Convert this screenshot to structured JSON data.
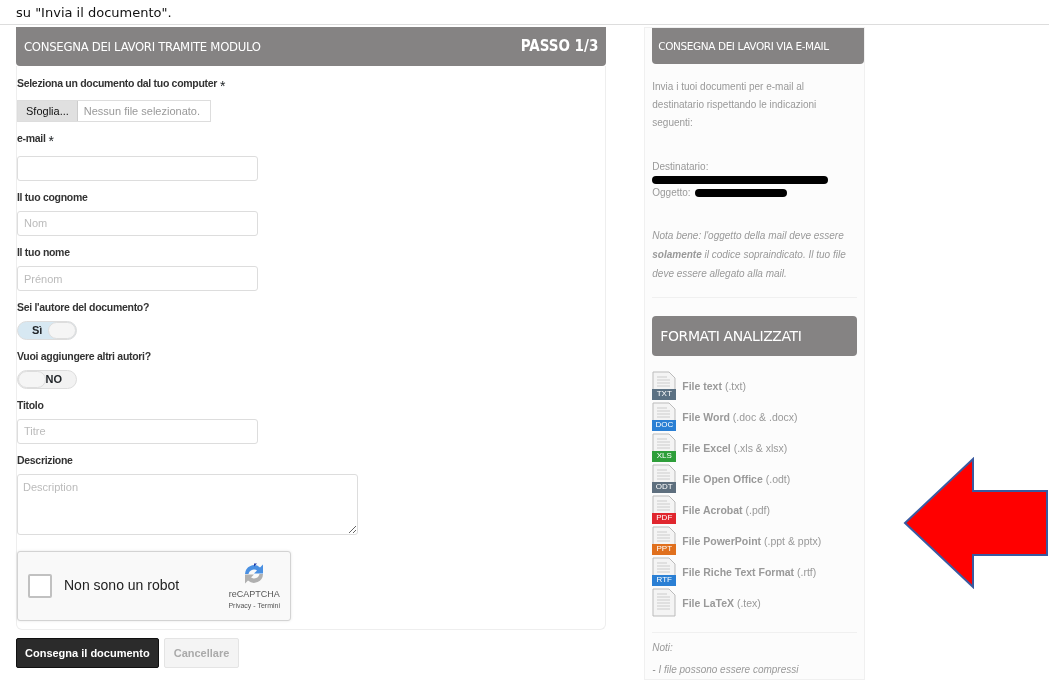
{
  "caption": "su \"Invia il documento\".",
  "form": {
    "title": "CONSEGNA DEI LAVORI TRAMITE MODULO",
    "step": "PASSO 1/3",
    "fields": [
      {
        "kind": "file",
        "label": "Seleziona un documento dal tuo computer",
        "required_mark": "*",
        "button": "Sfoglia...",
        "value": "Nessun file selezionato."
      },
      {
        "kind": "text",
        "label": "e-mail",
        "required_mark": "*"
      },
      {
        "kind": "text",
        "label": "Il tuo cognome",
        "placeholder": "Nom"
      },
      {
        "kind": "text",
        "label": "Il tuo nome",
        "placeholder": "Prénom"
      },
      {
        "kind": "toggle",
        "label": "Sei l'autore del documento?",
        "text": "Sì",
        "on": true
      },
      {
        "kind": "toggle",
        "label": "Vuoi aggiungere altri autori?",
        "text": "NO",
        "on": false
      },
      {
        "kind": "text",
        "label": "Titolo",
        "placeholder": "Titre"
      },
      {
        "kind": "textarea",
        "label": "Descrizione",
        "placeholder": "Description"
      }
    ],
    "captcha": {
      "label": "Non sono un robot",
      "checked": false,
      "brand": "reCAPTCHA",
      "links": "Privacy - Termini"
    }
  },
  "buttons": [
    {
      "label": "Consegna il documento",
      "kind": "primary"
    },
    {
      "label": "Cancellare",
      "kind": "secondary"
    }
  ],
  "email_panel": {
    "title": "CONSEGNA DEI LAVORI VIA E-MAIL",
    "intro": "Invia i tuoi documenti per e-mail al destinatario rispettando le indicazioni seguenti:",
    "recipient_label": "Destinatario:",
    "subject_label": "Oggetto:",
    "note": "Nota bene: l'oggetto della mail deve essere **solamente** il codice sopraindicato. Il tuo file deve essere allegato alla mail."
  },
  "formats_panel": {
    "title": "FORMATI ANALIZZATI",
    "items": [
      {
        "name": "File text",
        "ext": "(.txt)",
        "tag": "TXT",
        "color": "#5b7183"
      },
      {
        "name": "File Word",
        "ext": "(.doc & .docx)",
        "tag": "DOC",
        "color": "#2a7fd4"
      },
      {
        "name": "File Excel",
        "ext": "(.xls & xlsx)",
        "tag": "XLS",
        "color": "#2e9e3a"
      },
      {
        "name": "File Open Office",
        "ext": "(.odt)",
        "tag": "ODT",
        "color": "#5e6f7e"
      },
      {
        "name": "File Acrobat",
        "ext": "(.pdf)",
        "tag": "PDF",
        "color": "#e0262e"
      },
      {
        "name": "File PowerPoint",
        "ext": "(.ppt & pptx)",
        "tag": "PPT",
        "color": "#e0701e"
      },
      {
        "name": "File Riche Text Format",
        "ext": "(.rtf)",
        "tag": "RTF",
        "color": "#2a7fd4"
      },
      {
        "name": "File LaTeX",
        "ext": "(.tex)"
      }
    ],
    "notes_title": "Noti:",
    "notes": [
      "- I file possono essere compressi"
    ]
  }
}
